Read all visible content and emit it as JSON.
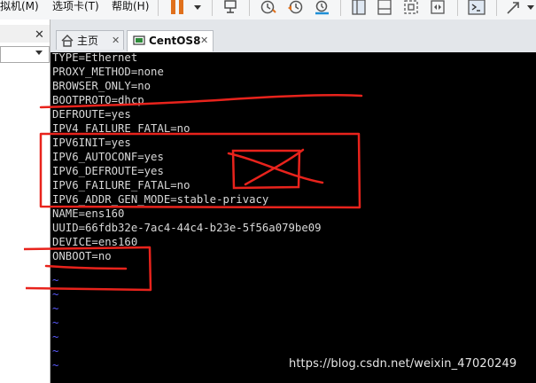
{
  "menu": {
    "items": [
      {
        "label": "拟机(M)"
      },
      {
        "label": "选项卡(T)"
      },
      {
        "label": "帮助(H)"
      }
    ]
  },
  "toolbar": {
    "icons": [
      "pause-icon",
      "dropdown-arrow-icon",
      "send-keys-icon",
      "snapshot-icon",
      "revert-snapshot-icon",
      "snapshot-manager-icon",
      "library-view-icon",
      "thumbnail-view-icon",
      "fit-guest-icon",
      "fullscreen-icon",
      "console-icon",
      "stretch-icon"
    ]
  },
  "tabs": [
    {
      "label": "主页",
      "icon": "home-icon",
      "active": false
    },
    {
      "label": "CentOS8",
      "icon": "vm-icon",
      "active": true
    }
  ],
  "terminal": {
    "lines": [
      "TYPE=Ethernet",
      "PROXY_METHOD=none",
      "BROWSER_ONLY=no",
      "BOOTPROTO=dhcp",
      "DEFROUTE=yes",
      "IPV4_FAILURE_FATAL=no",
      "IPV6INIT=yes",
      "IPV6_AUTOCONF=yes",
      "IPV6_DEFROUTE=yes",
      "IPV6_FAILURE_FATAL=no",
      "IPV6_ADDR_GEN_MODE=stable-privacy",
      "NAME=ens160",
      "UUID=66fdb32e-7ac4-44c4-b23e-5f56a079be09",
      "DEVICE=ens160",
      "ONBOOT=no"
    ],
    "tilde": "~",
    "tilde_count": 7
  },
  "watermark": "https://blog.csdn.net/weixin_47020249",
  "colors": {
    "terminal_bg": "#000000",
    "terminal_fg": "#d8d8d8",
    "tilde": "#5a5aff",
    "annotation": "#e8231c",
    "pause": "#e0701c"
  }
}
